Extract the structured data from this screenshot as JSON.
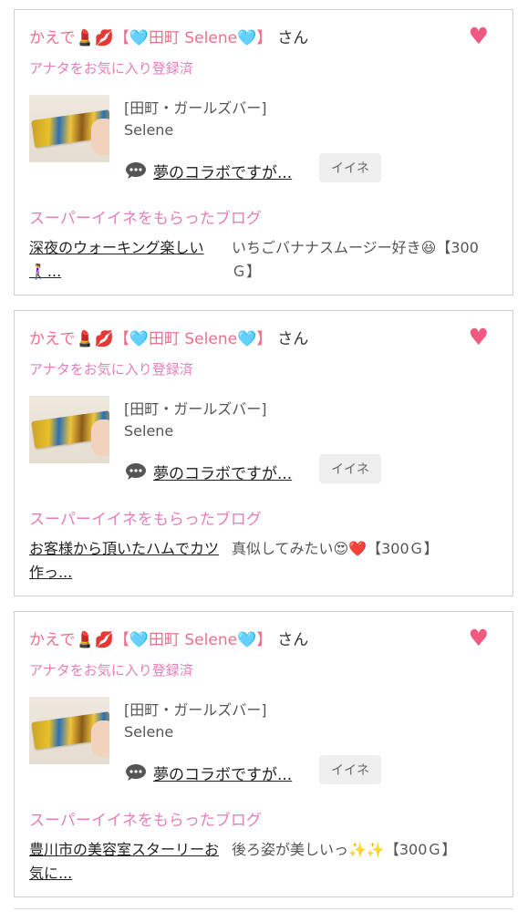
{
  "colors": {
    "pink": "#ee6f8c",
    "link_pink": "#e57fb9",
    "heart": "#f05a80",
    "button_bg": "#efefef"
  },
  "cards": [
    {
      "sender": "かえで💄💋【🩵田町 Selene🩵】",
      "san": "さん",
      "fav_status": "アナタをお気に入り登録済",
      "shop": "[田町・ガールズバー]",
      "cast": "Selene",
      "post_title": "夢のコラボですが...",
      "iine_label": "イイネ",
      "super_label": "スーパーイイネをもらったブログ",
      "blog_title": "深夜のウォーキング楽しい🚶‍♀️...",
      "comment": "いちごバナナスムージー好き😆【300Ｇ】",
      "heart_icon": "heart-icon",
      "message_icon": "speech-bubble-icon"
    },
    {
      "sender": "かえで💄💋【🩵田町 Selene🩵】",
      "san": "さん",
      "fav_status": "アナタをお気に入り登録済",
      "shop": "[田町・ガールズバー]",
      "cast": "Selene",
      "post_title": "夢のコラボですが...",
      "iine_label": "イイネ",
      "super_label": "スーパーイイネをもらったブログ",
      "blog_title": "お客様から頂いたハムでカツ作っ...",
      "comment": "真似してみたい😍❤️【300Ｇ】",
      "heart_icon": "heart-icon",
      "message_icon": "speech-bubble-icon"
    },
    {
      "sender": "かえで💄💋【🩵田町 Selene🩵】",
      "san": "さん",
      "fav_status": "アナタをお気に入り登録済",
      "shop": "[田町・ガールズバー]",
      "cast": "Selene",
      "post_title": "夢のコラボですが...",
      "iine_label": "イイネ",
      "super_label": "スーパーイイネをもらったブログ",
      "blog_title": "豊川市の美容室スターリーお気に...",
      "comment": "後ろ姿が美しいっ✨✨【300Ｇ】",
      "heart_icon": "heart-icon",
      "message_icon": "speech-bubble-icon"
    }
  ]
}
